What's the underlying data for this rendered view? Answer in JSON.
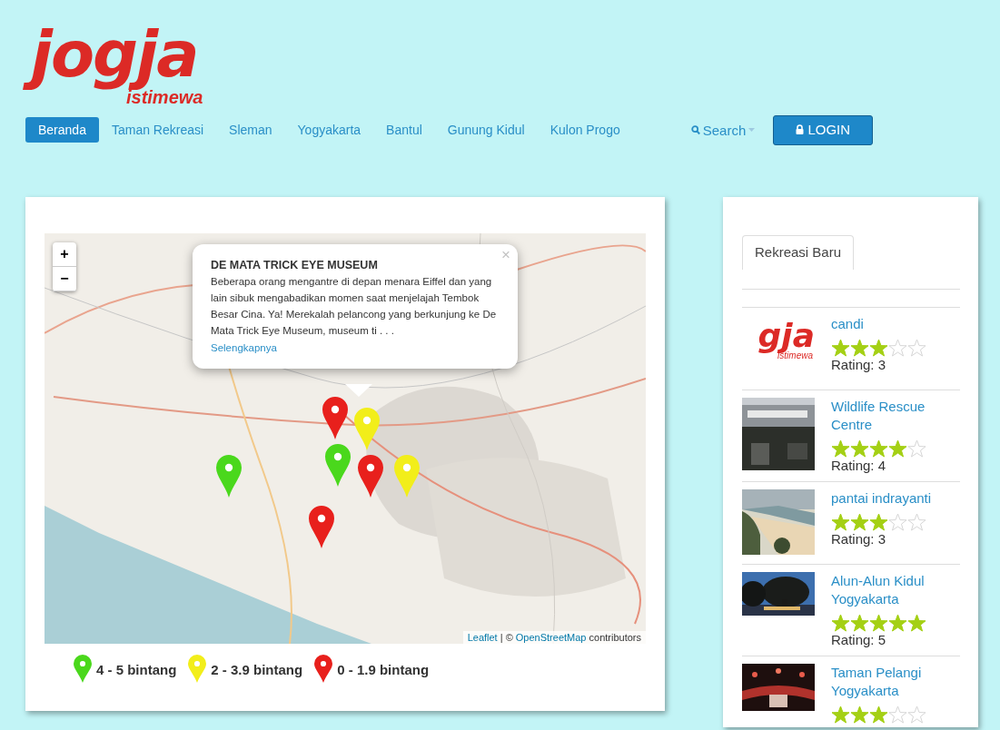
{
  "logo": {
    "main": "jogja",
    "sub": "istimewa"
  },
  "nav": [
    {
      "label": "Beranda",
      "selected": true
    },
    {
      "label": "Taman Rekreasi",
      "selected": false
    },
    {
      "label": "Sleman",
      "selected": false
    },
    {
      "label": "Yogyakarta",
      "selected": false
    },
    {
      "label": "Bantul",
      "selected": false
    },
    {
      "label": "Gunung Kidul",
      "selected": false
    },
    {
      "label": "Kulon Progo",
      "selected": false
    }
  ],
  "search": {
    "label": "Search"
  },
  "login": {
    "label": "LOGIN"
  },
  "map": {
    "zoom_in": "+",
    "zoom_out": "−",
    "popup": {
      "title": "DE MATA TRICK EYE MUSEUM",
      "text": "Beberapa orang mengantre di depan menara Eiffel dan yang lain sibuk mengabadikan momen saat menjelajah Tembok Besar Cina. Ya! Merekalah pelancong yang berkunjung ke De Mata Trick Eye Museum, museum ti . . .",
      "link": "Selengkapnya",
      "close": "×"
    },
    "markers": [
      {
        "color": "#e8201c"
      },
      {
        "color": "#f2ee1a"
      },
      {
        "color": "#4ad81c"
      },
      {
        "color": "#e8201c"
      },
      {
        "color": "#4ad81c"
      },
      {
        "color": "#f2ee1a"
      },
      {
        "color": "#e8201c"
      }
    ],
    "attribution": {
      "leaflet": "Leaflet",
      "separator": "| ©",
      "osm": "OpenStreetMap",
      "rest": "contributors"
    }
  },
  "legend": [
    {
      "label": "4 - 5 bintang",
      "color": "#4ad81c"
    },
    {
      "label": "2 - 3.9 bintang",
      "color": "#f2ee1a"
    },
    {
      "label": "0 - 1.9 bintang",
      "color": "#e8201c"
    }
  ],
  "sidebar": {
    "tab": {
      "label": "Rekreasi Baru",
      "selected": true
    },
    "items": [
      {
        "kind": "logo",
        "logo_main": "gja",
        "logo_sub": "istimewa",
        "title": "candi",
        "stars": 3,
        "rating": "Rating: 3"
      },
      {
        "kind": "picture",
        "title": "Wildlife Rescue Centre",
        "stars": 4,
        "rating": "Rating: 4"
      },
      {
        "kind": "picture",
        "title": "pantai indrayanti",
        "stars": 3,
        "rating": "Rating: 3"
      },
      {
        "kind": "picture",
        "title": "Alun-Alun Kidul Yogyakarta",
        "stars": 5,
        "rating": "Rating: 5"
      },
      {
        "kind": "picture",
        "title": "Taman Pelangi Yogyakarta",
        "stars": 3
      }
    ]
  }
}
